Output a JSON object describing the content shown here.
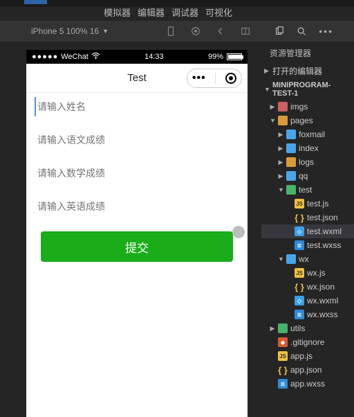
{
  "menus": {
    "simulator": "模拟器",
    "editor": "编辑器",
    "debugger": "调试器",
    "visualize": "可视化"
  },
  "toolbar": {
    "device": "iPhone 5 100% 16"
  },
  "statusbar": {
    "carrier": "WeChat",
    "time": "14:33",
    "battery": "99%"
  },
  "nav": {
    "title": "Test"
  },
  "form": {
    "name_ph": "请输入姓名",
    "chinese_ph": "请输入语文成绩",
    "math_ph": "请输入数学成绩",
    "english_ph": "请输入英语成绩",
    "submit": "提交"
  },
  "explorer": {
    "title": "资源管理器",
    "open_editors": "打开的编辑器",
    "project": "MINIPROGRAM-TEST-1",
    "tree": {
      "imgs": "imgs",
      "pages": "pages",
      "foxmail": "foxmail",
      "index": "index",
      "logs": "logs",
      "qq": "qq",
      "test": "test",
      "test_js": "test.js",
      "test_json": "test.json",
      "test_wxml": "test.wxml",
      "test_wxss": "test.wxss",
      "wx": "wx",
      "wx_js": "wx.js",
      "wx_json": "wx.json",
      "wx_wxml": "wx.wxml",
      "wx_wxss": "wx.wxss",
      "utils": "utils",
      "gitignore": ".gitignore",
      "app_js": "app.js",
      "app_json": "app.json",
      "app_wxss": "app.wxss"
    }
  }
}
